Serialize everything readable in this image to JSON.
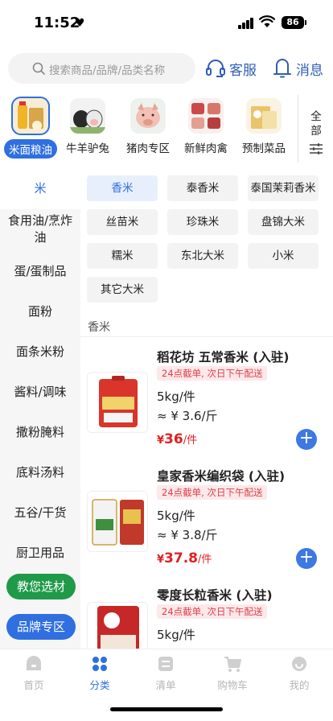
{
  "status_bar": {
    "time": "11:52",
    "battery": "86"
  },
  "header": {
    "search_placeholder": "搜索商品/品牌/品类名称",
    "service_label": "客服",
    "message_label": "消息"
  },
  "categories": [
    {
      "label": "米面粮油",
      "active": true
    },
    {
      "label": "牛羊驴兔",
      "active": false
    },
    {
      "label": "猪肉专区",
      "active": false
    },
    {
      "label": "新鲜肉禽",
      "active": false
    },
    {
      "label": "预制菜品",
      "active": false
    }
  ],
  "all_categories_label": "全部",
  "sidebar": {
    "items": [
      "米",
      "食用油/烹炸油",
      "蛋/蛋制品",
      "面粉",
      "面条米粉",
      "酱料/调味",
      "撒粉腌料",
      "底料汤料",
      "五谷/干货",
      "厨卫用品"
    ],
    "active_index": 0,
    "pill_1": {
      "label": "教您选材",
      "color": "#1f9a48"
    },
    "pill_2": {
      "label": "品牌专区",
      "color": "#2f6fe0"
    }
  },
  "subcategories": [
    "香米",
    "泰香米",
    "泰国茉莉香米",
    "丝苗米",
    "珍珠米",
    "盘锦大米",
    "糯米",
    "东北大米",
    "小米",
    "其它大米"
  ],
  "active_subcategory": "香米",
  "section_title": "香米",
  "products": [
    {
      "title": "稻花坊 五常香米 (入驻)",
      "badge": "24点截单, 次日下午配送",
      "unit": "5kg/件",
      "per": "≈ ¥ 3.6/斤",
      "price_symbol": "¥",
      "price": "36",
      "price_unit": "/件"
    },
    {
      "title": "皇家香米编织袋 (入驻)",
      "badge": "24点截单, 次日下午配送",
      "unit": "5kg/件",
      "per": "≈ ¥ 3.8/斤",
      "price_symbol": "¥",
      "price": "37.8",
      "price_unit": "/件"
    },
    {
      "title": "零度长粒香米 (入驻)",
      "badge": "24点截单, 次日下午配送",
      "unit": "5kg/件",
      "per": "",
      "price_symbol": "",
      "price": "",
      "price_unit": ""
    }
  ],
  "tabbar": {
    "items": [
      "首页",
      "分类",
      "清单",
      "购物车",
      "我的"
    ],
    "active_index": 1
  },
  "colors": {
    "accent": "#2f6fe0",
    "price": "#e02020",
    "badge_bg": "#fde9ea",
    "green": "#1f9a48"
  }
}
